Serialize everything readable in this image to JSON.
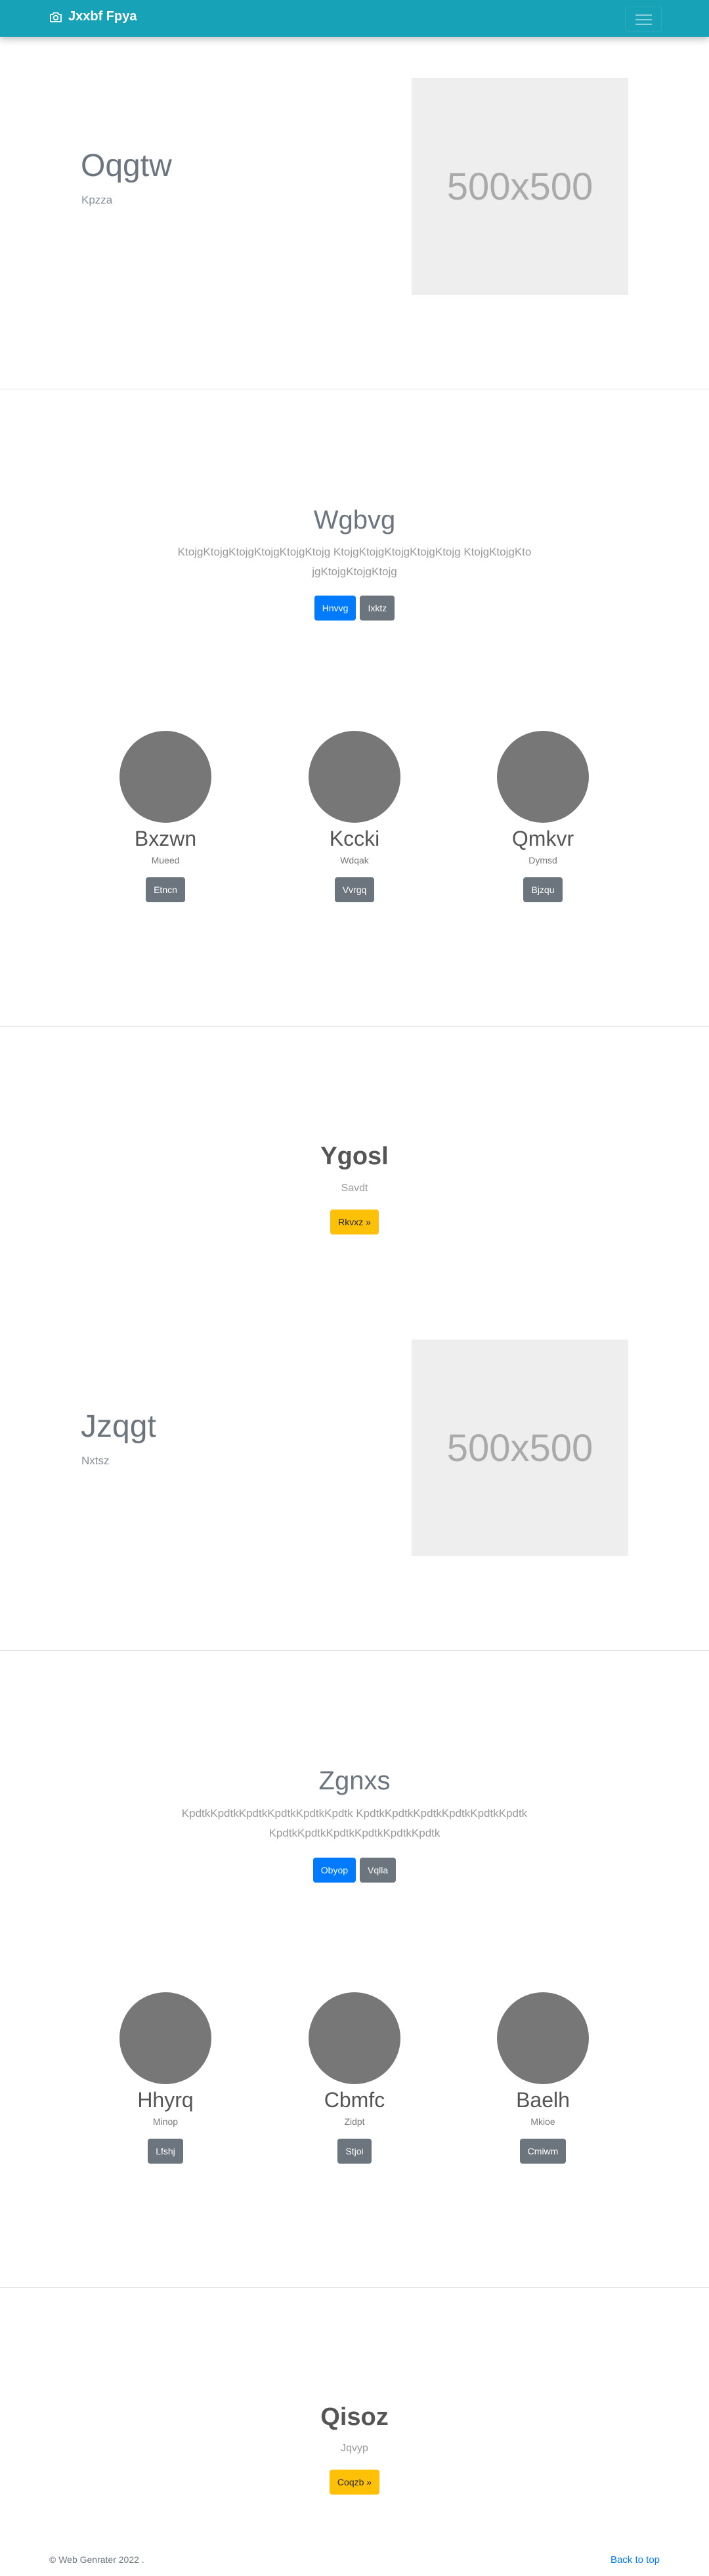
{
  "navbar": {
    "brand": "Jxxbf Fpya",
    "brand_icon": "camera-icon",
    "toggler_icon": "hamburger-menu-icon"
  },
  "hero1": {
    "title": "Oqgtw",
    "subtitle": "Kpzza",
    "image_label": "500x500"
  },
  "section1": {
    "title": "Wgbvg",
    "lead": "KtojgKtojgKtojgKtojgKtojgKtojg KtojgKtojgKtojgKtojgKtojg KtojgKtojgKtojgKtojgKtojgKtojg",
    "primary_button": "Hnvvg",
    "secondary_button": "Ixktz",
    "cards": [
      {
        "title": "Bxzwn",
        "subtitle": "Mueed",
        "button": "Etncn"
      },
      {
        "title": "Kccki",
        "subtitle": "Wdqak",
        "button": "Vvrgq"
      },
      {
        "title": "Qmkvr",
        "subtitle": "Dymsd",
        "button": "Bjzqu"
      }
    ]
  },
  "cta1": {
    "title": "Ygosl",
    "subtitle": "Savdt",
    "button": "Rkvxz »"
  },
  "hero2": {
    "title": "Jzqgt",
    "subtitle": "Nxtsz",
    "image_label": "500x500"
  },
  "section2": {
    "title": "Zgnxs",
    "lead": "KpdtkKpdtkKpdtkKpdtkKpdtkKpdtk KpdtkKpdtkKpdtkKpdtkKpdtkKpdtk KpdtkKpdtkKpdtkKpdtkKpdtkKpdtk",
    "primary_button": "Obyop",
    "secondary_button": "Vqlla",
    "cards": [
      {
        "title": "Hhyrq",
        "subtitle": "Minop",
        "button": "Lfshj"
      },
      {
        "title": "Cbmfc",
        "subtitle": "Zidpt",
        "button": "Stjoi"
      },
      {
        "title": "Baelh",
        "subtitle": "Mkioe",
        "button": "Cmiwm"
      }
    ]
  },
  "cta2": {
    "title": "Qisoz",
    "subtitle": "Jqvyp",
    "button": "Coqzb »"
  },
  "footer": {
    "copyright": "© Web Genrater 2022 .",
    "back_to_top": "Back to top"
  }
}
